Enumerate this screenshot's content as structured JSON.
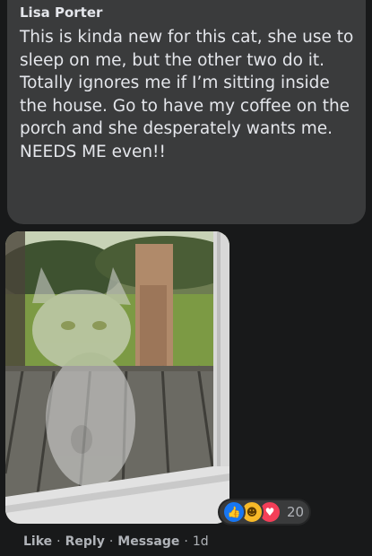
{
  "comment": {
    "author": "Lisa Porter",
    "text": "This is kinda new for this cat, she use to sleep on me, but the other two do it. Totally ignores me if I’m sitting inside the house. Go to have my coffee on the porch and she desperately wants me. NEEDS ME even!!"
  },
  "reactions": {
    "icons": [
      "like-icon",
      "haha-icon",
      "love-icon"
    ],
    "count": "20",
    "colors": {
      "like": "#1877f2",
      "haha": "#f7b928",
      "love": "#f33e58"
    }
  },
  "actions": {
    "like": "Like",
    "reply": "Reply",
    "message": "Message",
    "separator": "·",
    "time": "1d"
  }
}
